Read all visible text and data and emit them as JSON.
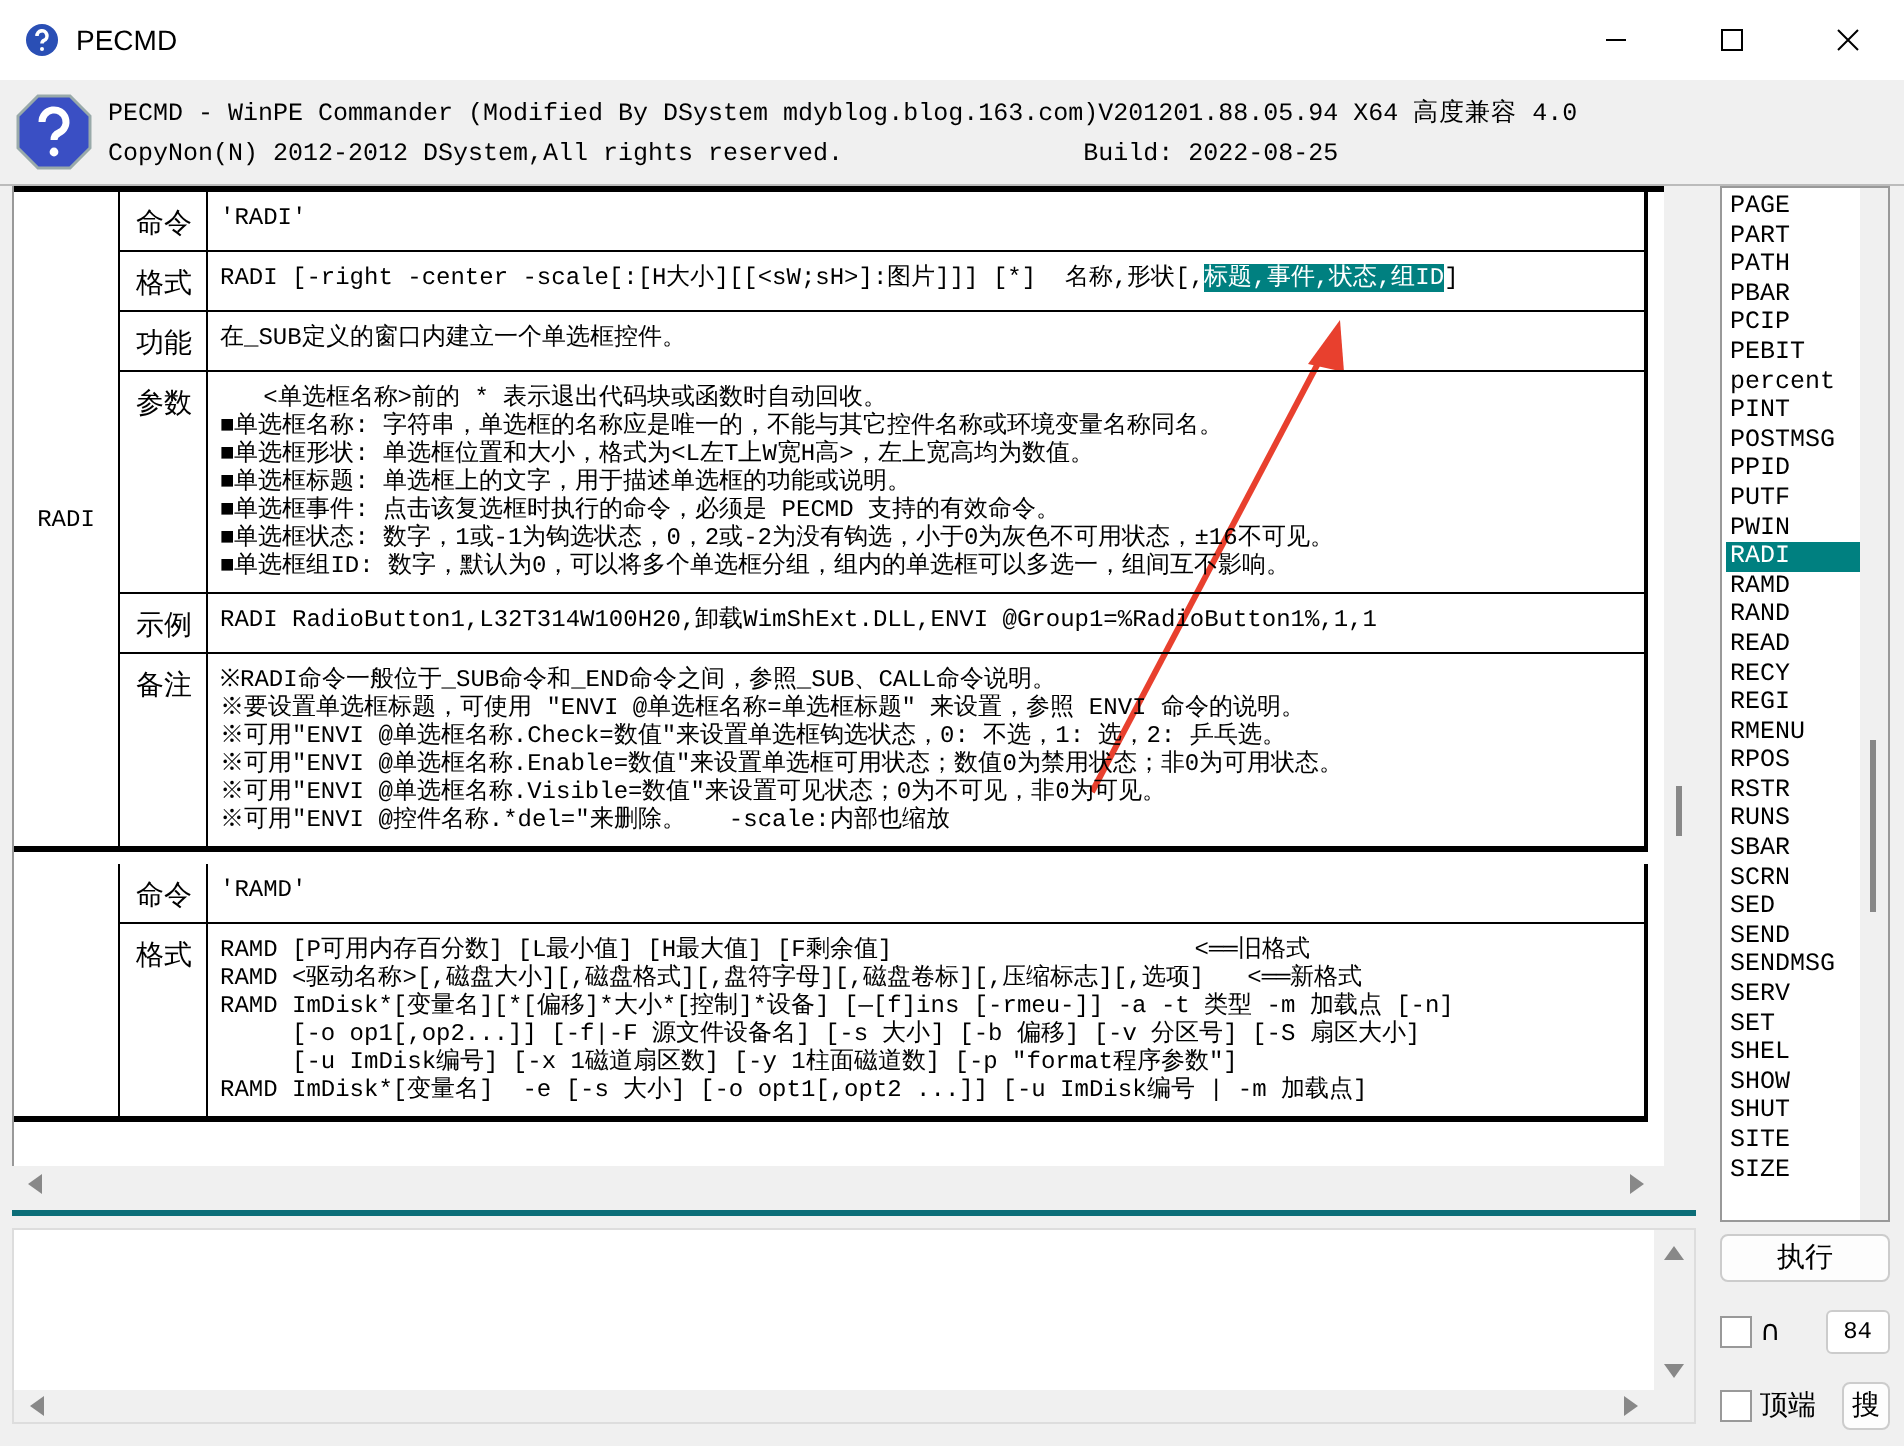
{
  "window": {
    "title": "PECMD"
  },
  "header": {
    "line1": "PECMD - WinPE Commander (Modified By DSystem mdyblog.blog.163.com)V201201.88.05.94 X64 高度兼容 4.0",
    "copyright": "CopyNon(N) 2012-2012 DSystem,All rights reserved.",
    "build": "Build: 2022-08-25"
  },
  "entries": [
    {
      "name": "RADI",
      "rows": [
        {
          "label": "命令",
          "lines": [
            "'RADI'"
          ]
        },
        {
          "label": "格式",
          "lines": [
            [
              {
                "text": "RADI [-right -center -scale[:[H大小][[<sW;sH>]:图片]]] [*]  名称,形状[,",
                "selected": false
              },
              {
                "text": "标题,事件,状态,组ID",
                "selected": true
              },
              {
                "text": "]",
                "selected": false
              }
            ]
          ]
        },
        {
          "label": "功能",
          "lines": [
            "在_SUB定义的窗口内建立一个单选框控件。"
          ]
        },
        {
          "label": "参数",
          "lines": [
            "   <单选框名称>前的 * 表示退出代码块或函数时自动回收。",
            "■单选框名称: 字符串，单选框的名称应是唯一的，不能与其它控件名称或环境变量名称同名。",
            "■单选框形状: 单选框位置和大小，格式为<L左T上W宽H高>，左上宽高均为数值。",
            "■单选框标题: 单选框上的文字，用于描述单选框的功能或说明。",
            "■单选框事件: 点击该复选框时执行的命令，必须是 PECMD 支持的有效命令。",
            "■单选框状态: 数字，1或-1为钩选状态，0，2或-2为没有钩选，小于0为灰色不可用状态，±16不可见。",
            "■单选框组ID: 数字，默认为0，可以将多个单选框分组，组内的单选框可以多选一，组间互不影响。"
          ]
        },
        {
          "label": "示例",
          "lines": [
            "RADI RadioButton1,L32T314W100H20,卸载WimShExt.DLL,ENVI @Group1=%RadioButton1%,1,1"
          ]
        },
        {
          "label": "备注",
          "lines": [
            "※RADI命令一般位于_SUB命令和_END命令之间，参照_SUB、CALL命令说明。",
            "※要设置单选框标题，可使用 \"ENVI @单选框名称=单选框标题\" 来设置，参照 ENVI 命令的说明。",
            "※可用\"ENVI @单选框名称.Check=数值\"来设置单选框钩选状态，0: 不选，1: 选，2: 乒乓选。",
            "※可用\"ENVI @单选框名称.Enable=数值\"来设置单选框可用状态；数值0为禁用状态；非0为可用状态。",
            "※可用\"ENVI @单选框名称.Visible=数值\"来设置可见状态；0为不可见，非0为可见。",
            "※可用\"ENVI @控件名称.*del=\"来删除。   -scale:内部也缩放"
          ]
        }
      ]
    },
    {
      "rows": [
        {
          "label": "命令",
          "lines": [
            "'RAMD'"
          ]
        },
        {
          "label": "格式",
          "lines": [
            "RAMD [P可用内存百分数] [L最小值] [H最大值] [F剩余值]                     <══旧格式",
            "RAMD <驱动名称>[,磁盘大小][,磁盘格式][,盘符字母][,磁盘卷标][,压缩标志][,选项]   <══新格式",
            "RAMD ImDisk*[变量名][*[偏移]*大小*[控制]*设备] [—[f]ins [-rmeu-]] -a -t 类型 -m 加载点 [-n]",
            "     [-o op1[,op2...]] [-f|-F 源文件设备名] [-s 大小] [-b 偏移] [-v 分区号] [-S 扇区大小]",
            "     [-u ImDisk编号] [-x 1磁道扇区数] [-y 1柱面磁道数] [-p \"format程序参数\"]",
            "RAMD ImDisk*[变量名]  -e [-s 大小] [-o opt1[,opt2 ...]] [-u ImDisk编号 | -m 加载点]"
          ]
        }
      ]
    }
  ],
  "commands": [
    {
      "label": "PAGE",
      "selected": false
    },
    {
      "label": "PART",
      "selected": false
    },
    {
      "label": "PATH",
      "selected": false
    },
    {
      "label": "PBAR",
      "selected": false
    },
    {
      "label": "PCIP",
      "selected": false
    },
    {
      "label": "PEBIT",
      "selected": false
    },
    {
      "label": "percent",
      "selected": false
    },
    {
      "label": "PINT",
      "selected": false
    },
    {
      "label": "POSTMSG",
      "selected": false
    },
    {
      "label": "PPID",
      "selected": false
    },
    {
      "label": "PUTF",
      "selected": false
    },
    {
      "label": "PWIN",
      "selected": false
    },
    {
      "label": "RADI",
      "selected": true
    },
    {
      "label": "RAMD",
      "selected": false
    },
    {
      "label": "RAND",
      "selected": false
    },
    {
      "label": "READ",
      "selected": false
    },
    {
      "label": "RECY",
      "selected": false
    },
    {
      "label": "REGI",
      "selected": false
    },
    {
      "label": "RMENU",
      "selected": false
    },
    {
      "label": "RPOS",
      "selected": false
    },
    {
      "label": "RSTR",
      "selected": false
    },
    {
      "label": "RUNS",
      "selected": false
    },
    {
      "label": "SBAR",
      "selected": false
    },
    {
      "label": "SCRN",
      "selected": false
    },
    {
      "label": "SED",
      "selected": false
    },
    {
      "label": "SEND",
      "selected": false
    },
    {
      "label": "SENDMSG",
      "selected": false
    },
    {
      "label": "SERV",
      "selected": false
    },
    {
      "label": "SET",
      "selected": false
    },
    {
      "label": "SHEL",
      "selected": false
    },
    {
      "label": "SHOW",
      "selected": false
    },
    {
      "label": "SHUT",
      "selected": false
    },
    {
      "label": "SITE",
      "selected": false
    },
    {
      "label": "SIZE",
      "selected": false
    }
  ],
  "execute_button": "执行",
  "options": [
    {
      "label": "∩",
      "checked": false,
      "value": "84"
    },
    {
      "label": "顶端",
      "checked": false,
      "button": "搜"
    }
  ]
}
